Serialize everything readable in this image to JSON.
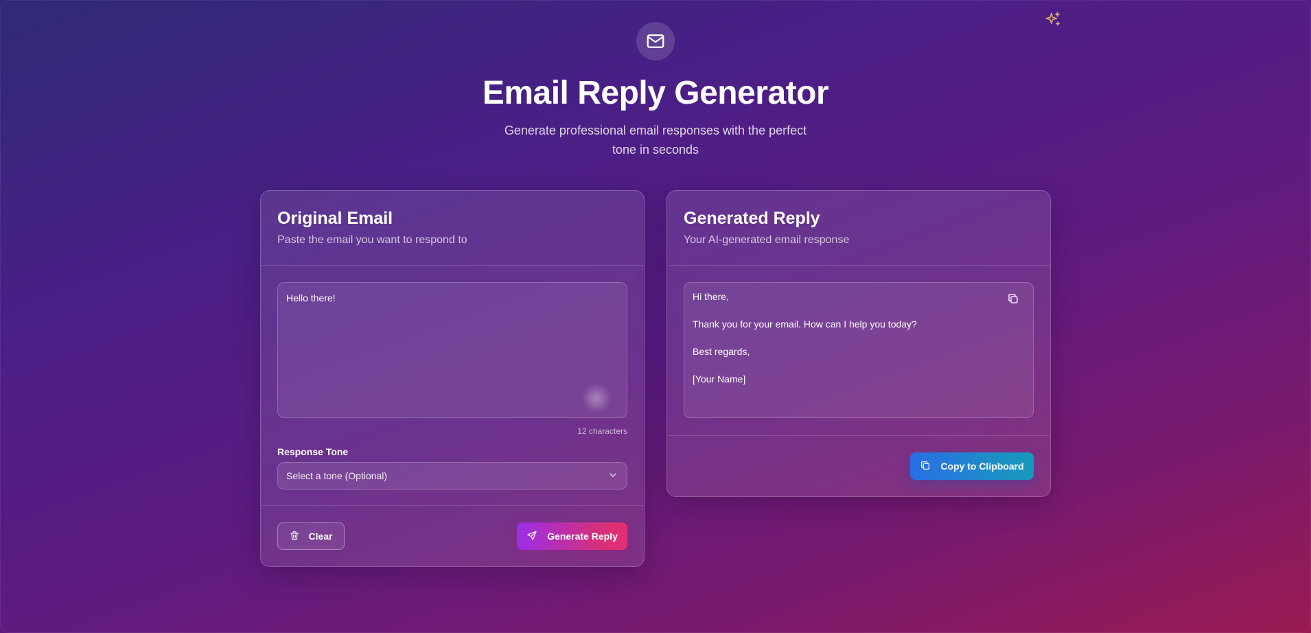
{
  "header": {
    "icon": "mail-icon",
    "title": "Email Reply Generator",
    "subtitle": "Generate professional email responses with the perfect tone in seconds",
    "corner_icon": "sparkles-icon"
  },
  "original": {
    "title": "Original Email",
    "subtitle": "Paste the email you want to respond to",
    "email_text": "Hello there!",
    "char_count": "12 characters",
    "tone_label": "Response Tone",
    "tone_placeholder": "Select a tone (Optional)",
    "clear_label": "Clear",
    "generate_label": "Generate Reply"
  },
  "reply": {
    "title": "Generated Reply",
    "subtitle": "Your AI-generated email response",
    "lines": [
      "Hi there,",
      "Thank you for your email. How can I help you today?",
      "Best regards,",
      "[Your Name]"
    ],
    "copy_label": "Copy to Clipboard"
  },
  "colors": {
    "generate_gradient": [
      "#9a2ee8",
      "#e62f6f"
    ],
    "copy_gradient": [
      "#2a6de6",
      "#1699b8"
    ],
    "sparkle": "#d9a36a"
  }
}
